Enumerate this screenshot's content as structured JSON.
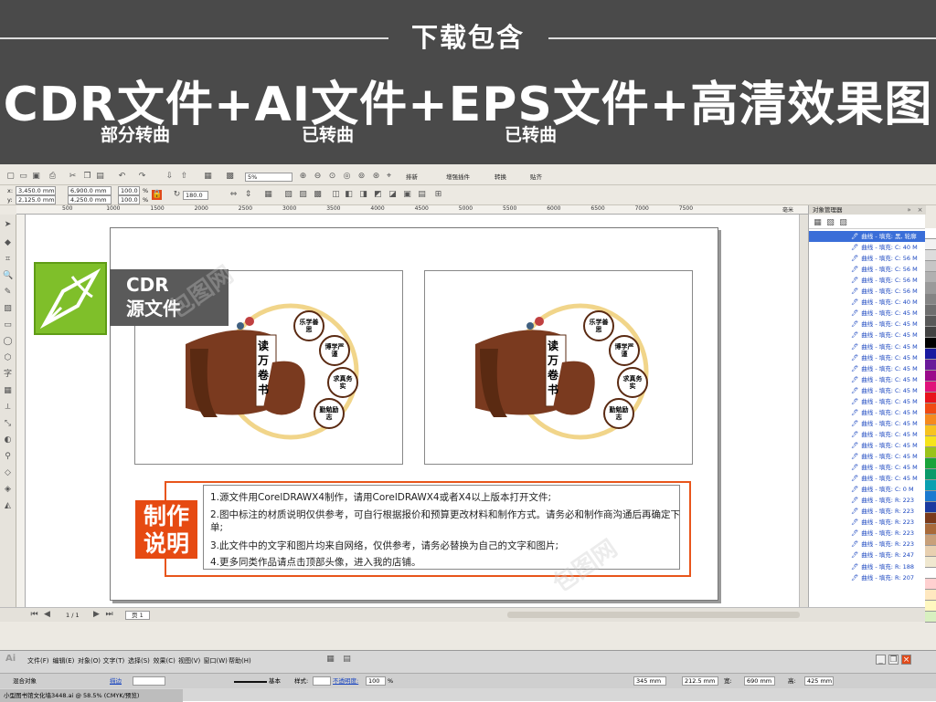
{
  "banner": {
    "title": "下载包含",
    "main": "CDR文件+AI文件+EPS文件+高清效果图",
    "sub1": "部分转曲",
    "sub2": "已转曲",
    "sub3": "已转曲"
  },
  "corel": {
    "toolbar": {
      "zoom": "5%",
      "btn_sort": "排新",
      "btn_plugin": "增强插件",
      "btn_convert": "转换",
      "btn_paste": "贴齐"
    },
    "propbar": {
      "x": "3,450.0 mm",
      "y": "2,125.0 mm",
      "w": "6,900.0 mm",
      "h": "4,250.0 mm",
      "sx": "100.0",
      "sy": "100.0",
      "sx_unit": "%",
      "sy_unit": "%",
      "angle": "180.0",
      "x_label": "x:",
      "y_label": "y:"
    },
    "ruler_ticks": [
      "500",
      "1000",
      "1500",
      "2000",
      "2500",
      "3000",
      "3500",
      "4000",
      "4500",
      "5000",
      "5500",
      "6000",
      "6500",
      "7000",
      "7500"
    ],
    "ruler_unit": "毫米",
    "panel": {
      "title": "对象管理器",
      "rows": [
        "曲线 - 填充: 黑, 轮廓",
        "曲线 - 填充: C: 40 M",
        "曲线 - 填充: C: 56 M",
        "曲线 - 填充: C: 56 M",
        "曲线 - 填充: C: 56 M",
        "曲线 - 填充: C: 56 M",
        "曲线 - 填充: C: 40 M",
        "曲线 - 填充: C: 45 M",
        "曲线 - 填充: C: 45 M",
        "曲线 - 填充: C: 45 M",
        "曲线 - 填充: C: 45 M",
        "曲线 - 填充: C: 45 M",
        "曲线 - 填充: C: 45 M",
        "曲线 - 填充: C: 45 M",
        "曲线 - 填充: C: 45 M",
        "曲线 - 填充: C: 45 M",
        "曲线 - 填充: C: 45 M",
        "曲线 - 填充: C: 45 M",
        "曲线 - 填充: C: 45 M",
        "曲线 - 填充: C: 45 M",
        "曲线 - 填充: C: 45 M",
        "曲线 - 填充: C: 45 M",
        "曲线 - 填充: C: 45 M",
        "曲线 - 填充: C: 0 M",
        "曲线 - 填充: R: 223",
        "曲线 - 填充: R: 223",
        "曲线 - 填充: R: 223",
        "曲线 - 填充: R: 223",
        "曲线 - 填充: R: 223",
        "曲线 - 填充: R: 247",
        "曲线 - 填充: R: 188",
        "曲线 - 填充: R: 207"
      ]
    },
    "palette": [
      "#ffffff",
      "#f2f2f2",
      "#dcdcdc",
      "#c6c6c6",
      "#b0b0b0",
      "#9a9a9a",
      "#848484",
      "#6e6e6e",
      "#585858",
      "#424242",
      "#000000",
      "#1a1aa0",
      "#6a1a9a",
      "#9a0a8a",
      "#e0137a",
      "#e8131c",
      "#f04a13",
      "#f58a1e",
      "#f7c31f",
      "#f6e41a",
      "#9ac31a",
      "#1aa33a",
      "#0a9a6a",
      "#0aa0b0",
      "#1a7ad0",
      "#1a3aa0",
      "#7a3a1a",
      "#a86a3a",
      "#c8a07a",
      "#e8d0b0",
      "#f0e8d0",
      "#ffffff",
      "#ffd0d0",
      "#ffe8c0",
      "#fff8c0",
      "#d8f0c0"
    ],
    "status": {
      "pages": "1 / 1",
      "page_tab": "页 1"
    },
    "badge": {
      "line1": "CDR",
      "line2": "源文件"
    }
  },
  "artwork": {
    "signs": [
      "乐学善思",
      "博学严谨",
      "求真务实",
      "勤勉励志"
    ],
    "scroll_text": "读万卷书",
    "red_box": {
      "line1": "制作",
      "line2": "说明"
    },
    "notes": [
      "1.源文件用CorelDRAWX4制作，请用CorelDRAWX4或者X4以上版本打开文件;",
      "2.图中标注的材质说明仅供参考，可自行根据报价和预算更改材料和制作方式。请务必和制作商沟通后再确定下单;",
      "3.此文件中的文字和图片均来自网络，仅供参考，请务必替换为自己的文字和图片;",
      "4.更多同类作品请点击顶部头像，进入我的店铺。"
    ]
  },
  "illustrator": {
    "logo": "Ai",
    "menu": [
      "文件(F)",
      "编辑(E)",
      "对象(O)",
      "文字(T)",
      "选择(S)",
      "效果(C)",
      "视图(V)",
      "窗口(W)",
      "帮助(H)"
    ],
    "toolbar": {
      "mode": "混合对象",
      "stroke": "描边",
      "style_label": "基本",
      "style": "样式:",
      "opacity": "不透明度:",
      "opacity_val": "100",
      "x": "345 mm",
      "y": "212.5 mm",
      "w_label": "宽:",
      "w": "690 mm",
      "h_label": "高:",
      "h": "425 mm",
      "unit": "%"
    },
    "tab": "小型图书馆文化墙3448.ai @ 58.5% (CMYK/预览)"
  }
}
